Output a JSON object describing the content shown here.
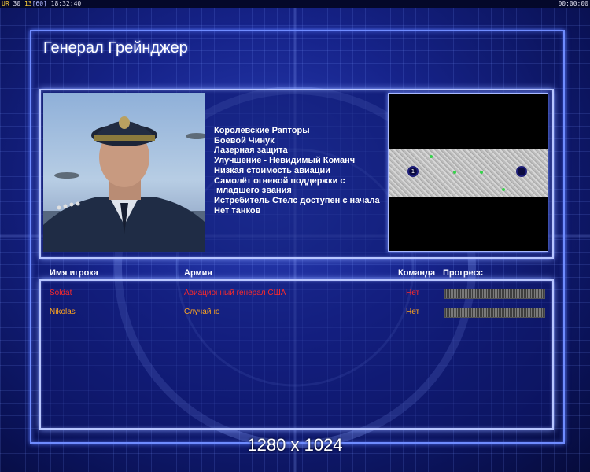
{
  "status_bar": {
    "ur_label": "UR",
    "value_a": "30",
    "value_b": "13",
    "fps": "[60]",
    "clock": "18:32:40",
    "timer": "00:00:00"
  },
  "title": "Генерал Грейнджер",
  "general": {
    "perks": [
      "Королевские Рапторы",
      "Боевой Чинук",
      "Лазерная защита",
      "Улучшение - Невидимый Команч",
      "Низкая стоимость авиации",
      "Самолёт огневой поддержки с",
      " младшего звания",
      "Истребитель Стелс доступен с начала",
      "Нет танков"
    ]
  },
  "minimap": {
    "start_1_label": "1"
  },
  "players_table": {
    "headers": {
      "name": "Имя игрока",
      "army": "Армия",
      "team": "Команда",
      "progress": "Прогресс"
    },
    "rows": [
      {
        "name": "Soldat",
        "army": "Авиационный генерал США",
        "team": "Нет",
        "progress": 0,
        "color": "#ff2a2a"
      },
      {
        "name": "Nikolas",
        "army": "Случайно",
        "team": "Нет",
        "progress": 0,
        "color": "#ffa51e"
      }
    ]
  },
  "resolution": "1280 x 1024",
  "colors": {
    "frame": "#6f8cff",
    "panel_border": "#b8c6ff",
    "background": "#16238a"
  }
}
